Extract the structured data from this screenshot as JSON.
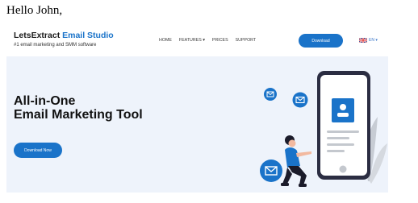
{
  "email": {
    "greeting": "Hello John,"
  },
  "header": {
    "brand_name": "LetsExtract",
    "brand_product": "Email Studio",
    "tagline": "#1 email marketing and SMM software",
    "menu": [
      {
        "label": "HOME"
      },
      {
        "label": "FEATURES ▾"
      },
      {
        "label": "PRICES"
      },
      {
        "label": "SUPPORT"
      }
    ],
    "download_label": "Download",
    "language": "EN ▾"
  },
  "hero": {
    "headline_line1": "All-in-One",
    "headline_line2": "Email Marketing Tool",
    "cta_label": "Download Now"
  },
  "colors": {
    "brand_blue": "#1a73c9",
    "hero_background": "#eef3fb",
    "phone_frame": "#2b2d42"
  },
  "icons": [
    "envelope-icon",
    "contact-card-icon",
    "uk-flag-icon",
    "person-figure",
    "plant-leaf"
  ]
}
